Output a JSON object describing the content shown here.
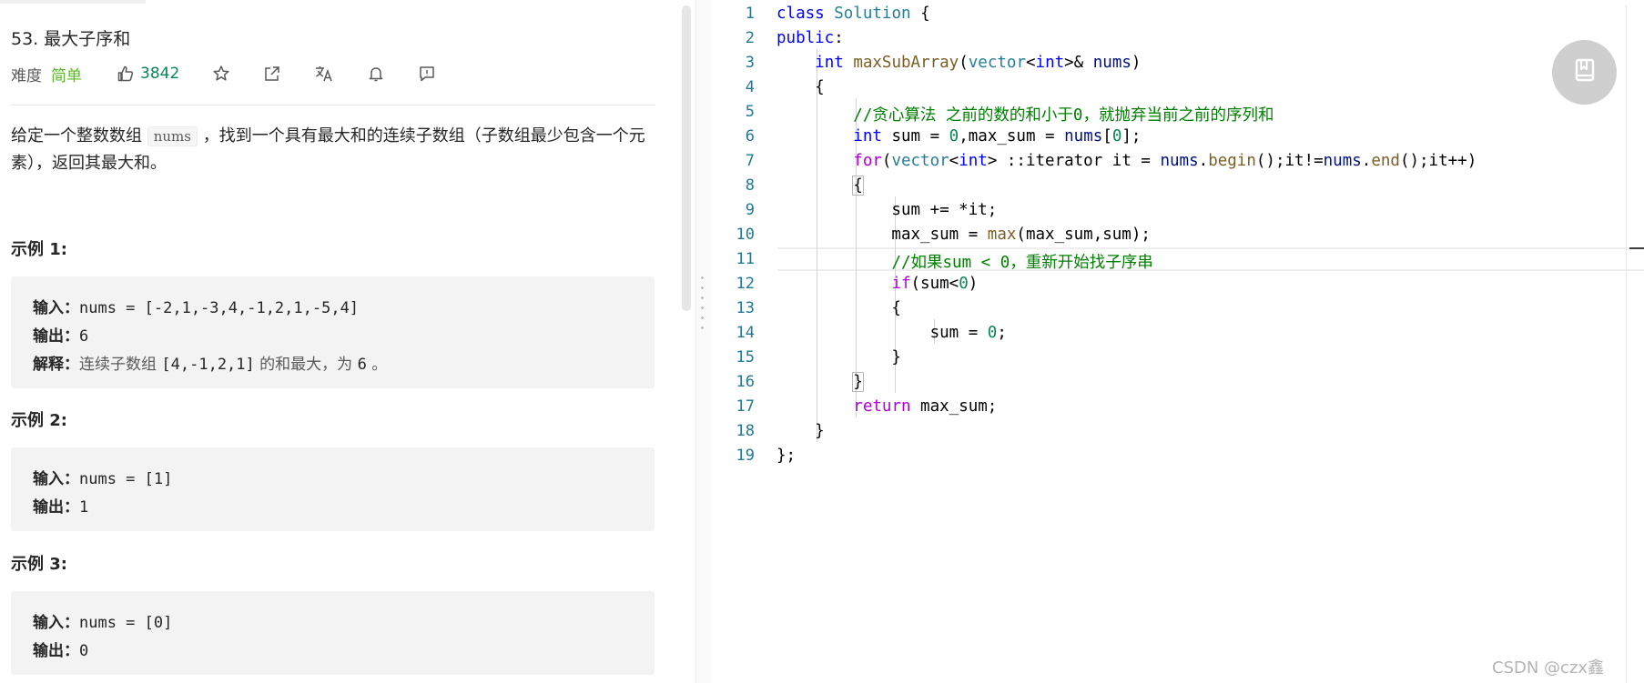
{
  "problem": {
    "title": "53. 最大子序和",
    "difficulty_label": "难度",
    "difficulty_value": "简单",
    "likes": "3842",
    "description_part1": "给定一个整数数组",
    "description_code": "nums",
    "description_part2": "，找到一个具有最大和的连续子数组（子数组最少包含一个元素），返回其最大和。",
    "icons": [
      "thumb-up-icon",
      "star-icon",
      "share-icon",
      "translate-icon",
      "bell-icon",
      "feedback-icon"
    ]
  },
  "examples": [
    {
      "title": "示例 1:",
      "input_label": "输入：",
      "input": "nums = [-2,1,-3,4,-1,2,1,-5,4]",
      "output_label": "输出：",
      "output": "6",
      "explain_label": "解释：",
      "explain_pre": "连续子数组 ",
      "explain_code": "[4,-1,2,1]",
      "explain_mid": " 的和最大，为 ",
      "explain_num": "6",
      "explain_end": " 。"
    },
    {
      "title": "示例 2:",
      "input_label": "输入：",
      "input": "nums = [1]",
      "output_label": "输出：",
      "output": "1"
    },
    {
      "title": "示例 3:",
      "input_label": "输入：",
      "input": "nums = [0]",
      "output_label": "输出：",
      "output": "0"
    }
  ],
  "editor": {
    "line_numbers": [
      "1",
      "2",
      "3",
      "4",
      "5",
      "6",
      "7",
      "8",
      "9",
      "10",
      "11",
      "12",
      "13",
      "14",
      "15",
      "16",
      "17",
      "18",
      "19"
    ],
    "comment1": "//贪心算法 之前的数的和小于0，就抛弃当前之前的序列和",
    "comment2": "//如果sum < 0，重新开始找子序串",
    "fab_icon": "notebook-icon"
  },
  "watermark": "CSDN @czx鑫"
}
